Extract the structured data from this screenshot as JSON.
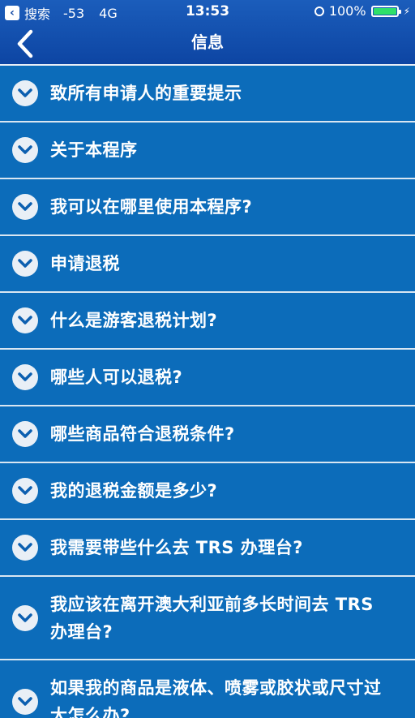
{
  "status_bar": {
    "back_app": "搜索",
    "signal": "-53",
    "network": "4G",
    "time": "13:53",
    "battery": "100%"
  },
  "nav": {
    "title": "信息"
  },
  "items": [
    {
      "label": "致所有申请人的重要提示"
    },
    {
      "label": "关于本程序"
    },
    {
      "label": "我可以在哪里使用本程序?"
    },
    {
      "label": "申请退税"
    },
    {
      "label": "什么是游客退税计划?"
    },
    {
      "label": "哪些人可以退税?"
    },
    {
      "label": "哪些商品符合退税条件?"
    },
    {
      "label": "我的退税金额是多少?"
    },
    {
      "label": "我需要带些什么去 TRS 办理台?"
    },
    {
      "label": "我应该在离开澳大利亚前多长时间去 TRS 办理台?"
    },
    {
      "label": "如果我的商品是液体、喷雾或胶状或尺寸过大怎么办?"
    }
  ],
  "colors": {
    "header_top": "#1b5dbb",
    "list_bg": "#0c6cba",
    "divider": "#d9e6f2",
    "chevron_bg": "#e9eff6",
    "chevron_fg": "#0c5fb0",
    "battery_fill": "#2ee06a"
  }
}
